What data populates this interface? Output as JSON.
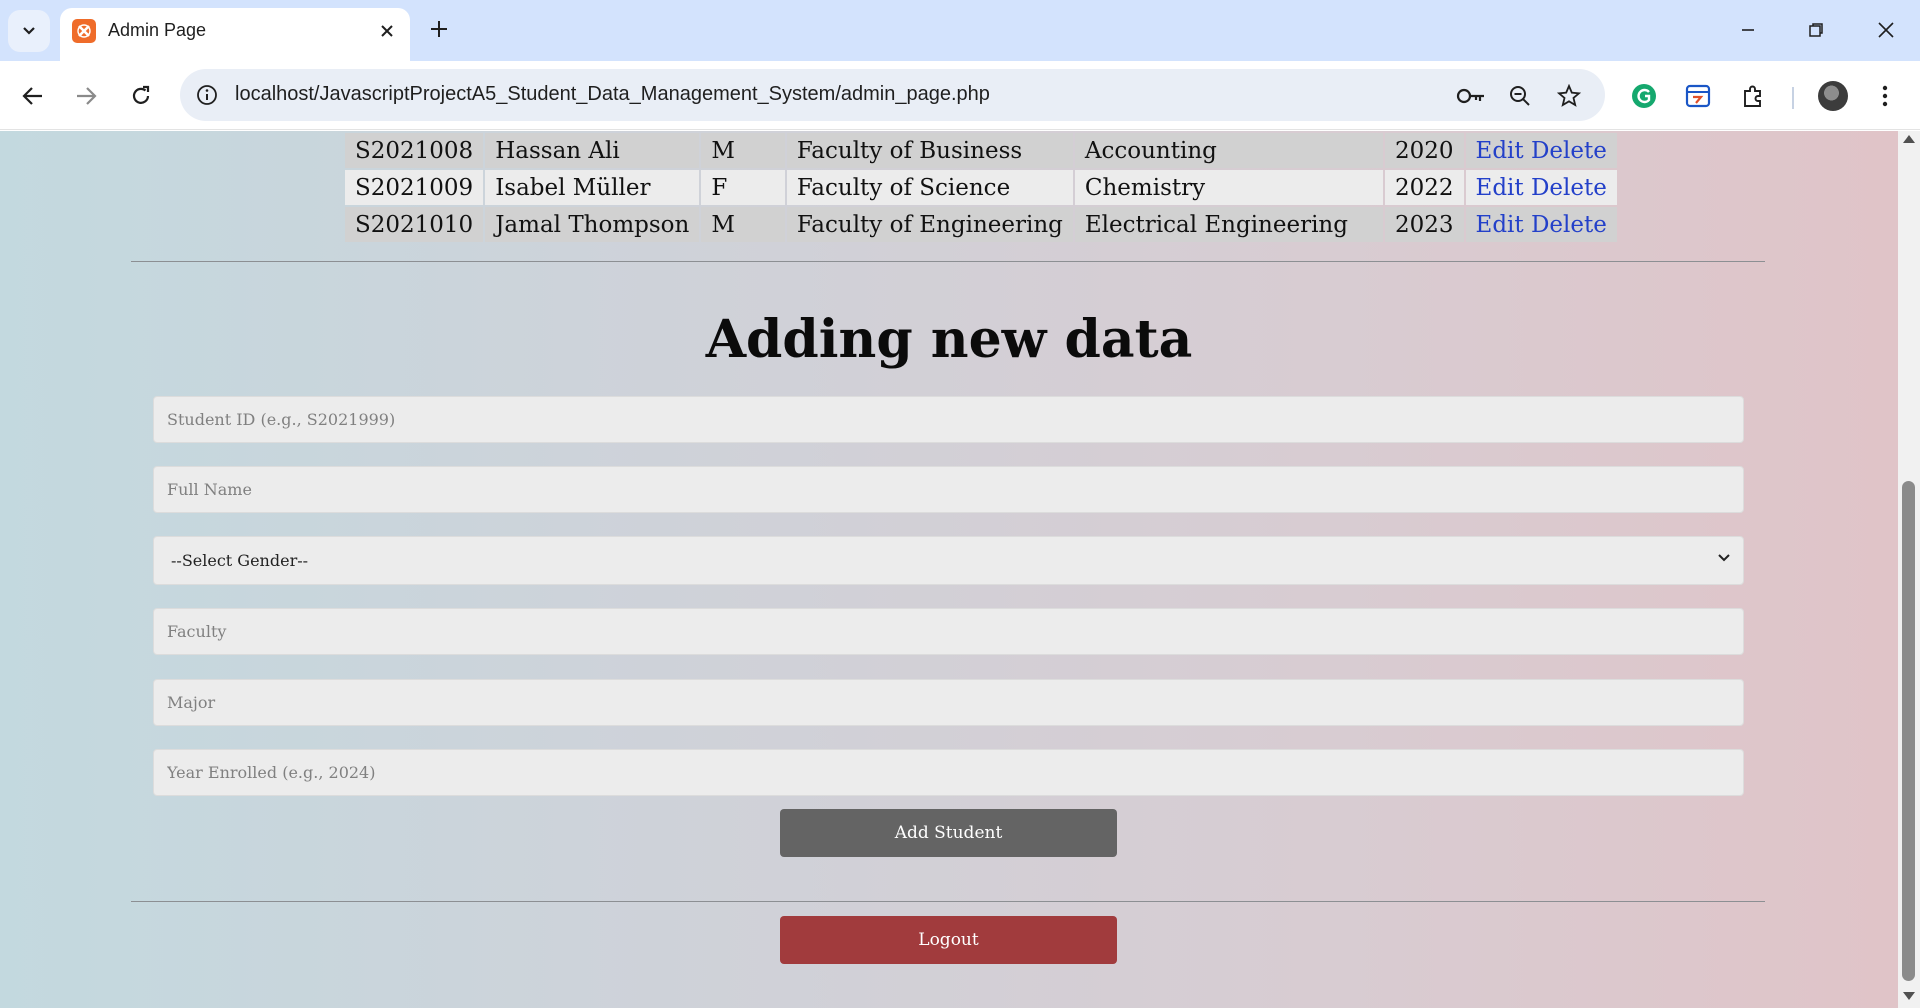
{
  "browser": {
    "tab_title": "Admin Page",
    "url": "localhost/JavascriptProjectA5_Student_Data_Management_System/admin_page.php"
  },
  "table": {
    "rows": [
      {
        "id": "S2021008",
        "name": "Hassan Ali",
        "gender": "M",
        "faculty": "Faculty of Business",
        "major": "Accounting",
        "year": "2020",
        "edit": "Edit",
        "delete": "Delete"
      },
      {
        "id": "S2021009",
        "name": "Isabel Müller",
        "gender": "F",
        "faculty": "Faculty of Science",
        "major": "Chemistry",
        "year": "2022",
        "edit": "Edit",
        "delete": "Delete"
      },
      {
        "id": "S2021010",
        "name": "Jamal Thompson",
        "gender": "M",
        "faculty": "Faculty of Engineering",
        "major": "Electrical Engineering",
        "year": "2023",
        "edit": "Edit",
        "delete": "Delete"
      }
    ]
  },
  "form": {
    "title": "Adding new data",
    "student_id_placeholder": "Student ID (e.g., S2021999)",
    "full_name_placeholder": "Full Name",
    "gender_selected": "--Select Gender--",
    "faculty_placeholder": "Faculty",
    "major_placeholder": "Major",
    "year_placeholder": "Year Enrolled (e.g., 2024)",
    "submit_label": "Add Student"
  },
  "logout_label": "Logout",
  "icons": {
    "tab_list": "chevron-down-icon",
    "favicon": "xampp-icon",
    "close": "close-icon",
    "new_tab": "plus-icon",
    "back": "arrow-left-icon",
    "forward": "arrow-right-icon",
    "reload": "reload-icon",
    "site_info": "info-icon",
    "passwords": "key-icon",
    "zoom": "zoom-out-icon",
    "bookmark": "star-icon",
    "grammarly": "grammarly-icon",
    "extension_blue": "extension-icon",
    "extensions": "puzzle-icon",
    "menu": "kebab-menu-icon"
  },
  "colors": {
    "tabstrip": "#d3e3fd",
    "link": "#2340c9",
    "add_button": "#646464",
    "logout_button": "#a13b3d"
  }
}
